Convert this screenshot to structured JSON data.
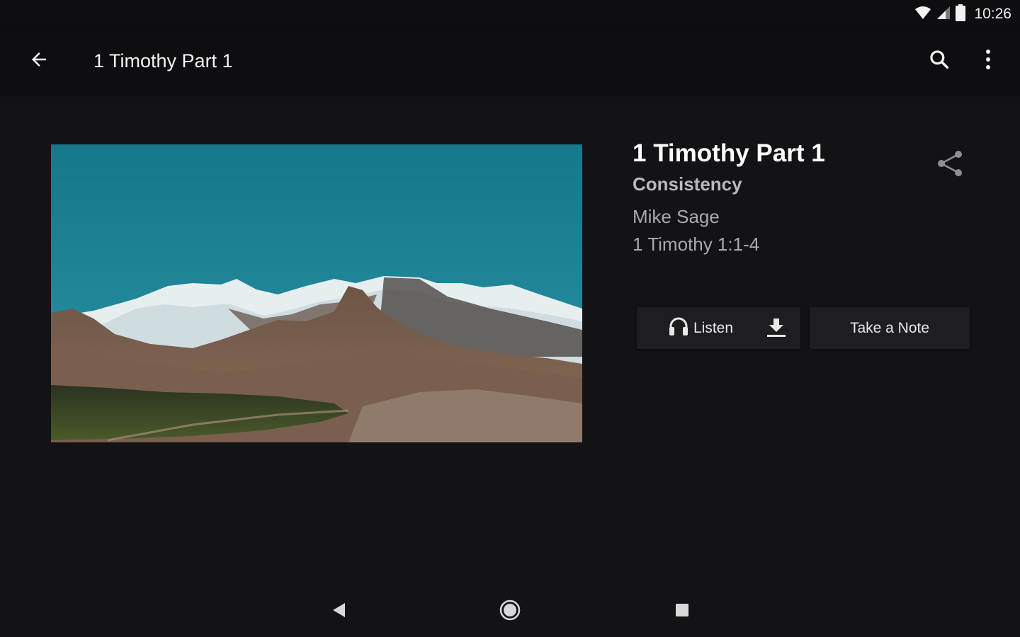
{
  "status_bar": {
    "time": "10:26",
    "icons": [
      "wifi-icon",
      "cellular-signal-icon",
      "battery-icon"
    ]
  },
  "app_bar": {
    "title": "1 Timothy Part 1",
    "icons": [
      "back-arrow-icon",
      "search-icon",
      "more-vert-icon"
    ]
  },
  "sermon": {
    "title": "1 Timothy Part 1",
    "series": "Consistency",
    "speaker": "Mike Sage",
    "scripture": "1 Timothy 1:1-4",
    "image": "mountain-landscape-image"
  },
  "actions": {
    "listen_label": "Listen",
    "note_label": "Take a Note",
    "icons": [
      "headphones-icon",
      "download-icon",
      "share-icon"
    ]
  },
  "nav_bar": {
    "icons": [
      "nav-back-icon",
      "nav-home-icon",
      "nav-recents-icon"
    ]
  },
  "colors": {
    "background": "#131316",
    "app_bar": "#0e0e10",
    "button": "#1e1e21",
    "series_text": "#b9b9bb",
    "meta_text": "#a9a9ab",
    "sky": "#1c7f92"
  }
}
